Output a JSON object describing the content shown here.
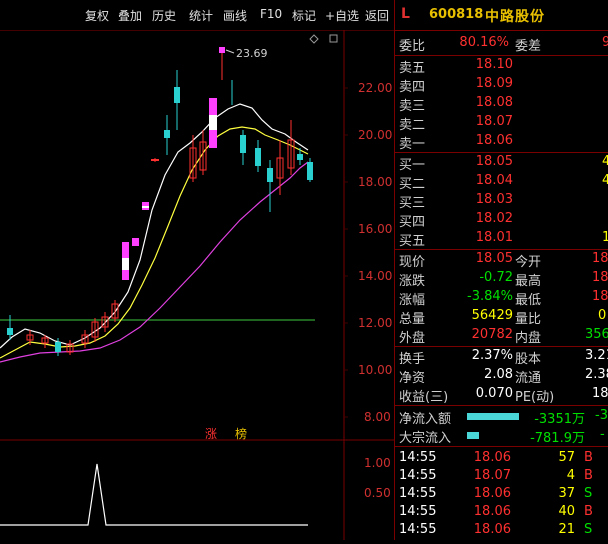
{
  "toolbar": {
    "items": [
      "复权",
      "叠加",
      "历史",
      "统计",
      "画线",
      "F10",
      "标记",
      "+自选",
      "返回"
    ]
  },
  "chart": {
    "price_axis": [
      "22.00",
      "20.00",
      "18.00",
      "16.00",
      "14.00",
      "12.00",
      "10.00",
      "8.00"
    ],
    "high_label": "23.69",
    "markers": [
      "涨",
      "榜"
    ],
    "indicator_axis": [
      "1.00",
      "0.50"
    ]
  },
  "stock": {
    "market": "L",
    "code": "600818",
    "name": "中路股份"
  },
  "order_ratio": {
    "label": "委比",
    "value": "80.16%",
    "label2": "委差",
    "value2": "9"
  },
  "asks": [
    {
      "label": "卖五",
      "price": "18.10"
    },
    {
      "label": "卖四",
      "price": "18.09"
    },
    {
      "label": "卖三",
      "price": "18.08"
    },
    {
      "label": "卖二",
      "price": "18.07"
    },
    {
      "label": "卖一",
      "price": "18.06"
    }
  ],
  "bids": [
    {
      "label": "买一",
      "price": "18.05",
      "vol": "4"
    },
    {
      "label": "买二",
      "price": "18.04",
      "vol": "4"
    },
    {
      "label": "买三",
      "price": "18.03",
      "vol": ""
    },
    {
      "label": "买四",
      "price": "18.02",
      "vol": ""
    },
    {
      "label": "买五",
      "price": "18.01",
      "vol": "1"
    }
  ],
  "quote": [
    {
      "l1": "现价",
      "v1": "18.05",
      "l2": "今开",
      "v2": "18"
    },
    {
      "l1": "涨跌",
      "v1": "-0.72",
      "l2": "最高",
      "v2": "18"
    },
    {
      "l1": "涨幅",
      "v1": "-3.84%",
      "l2": "最低",
      "v2": "18"
    },
    {
      "l1": "总量",
      "v1": "56429",
      "l2": "量比",
      "v2": "0"
    },
    {
      "l1": "外盘",
      "v1": "20782",
      "l2": "内盘",
      "v2": "356"
    }
  ],
  "fundamentals": [
    {
      "l1": "换手",
      "v1": "2.37%",
      "l2": "股本",
      "v2": "3.21"
    },
    {
      "l1": "净资",
      "v1": "2.08",
      "l2": "流通",
      "v2": "2.38"
    },
    {
      "l1": "收益(三)",
      "v1": "0.070",
      "l2": "PE(动)",
      "v2": "18"
    }
  ],
  "flows": [
    {
      "label": "净流入额",
      "value": "-3351万",
      "extra": "-3"
    },
    {
      "label": "大宗流入",
      "value": "-781.9万",
      "extra": "-"
    }
  ],
  "ticks": [
    {
      "time": "14:55",
      "price": "18.06",
      "vol": "57",
      "side": "B"
    },
    {
      "time": "14:55",
      "price": "18.07",
      "vol": "4",
      "side": "B"
    },
    {
      "time": "14:55",
      "price": "18.06",
      "vol": "37",
      "side": "S"
    },
    {
      "time": "14:55",
      "price": "18.06",
      "vol": "40",
      "side": "B"
    },
    {
      "time": "14:55",
      "price": "18.06",
      "vol": "21",
      "side": "S"
    }
  ],
  "colors": {
    "up": "#ff3030",
    "down": "#00e000",
    "accent": "#e8c000",
    "border": "#7a0000"
  }
}
